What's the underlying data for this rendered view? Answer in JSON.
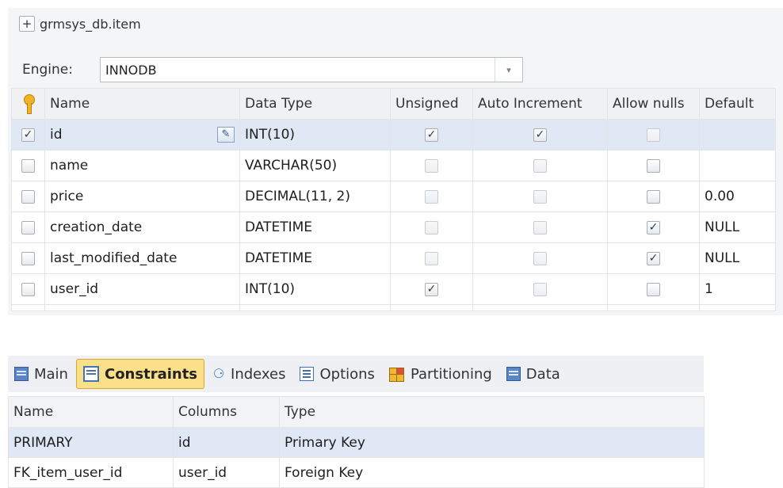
{
  "table_editor": {
    "title": "grmsys_db.item",
    "expand_symbol": "+",
    "engine": {
      "label": "Engine:",
      "value": "INNODB",
      "dropdown_arrow": "▾"
    },
    "columns_headers": [
      "Name",
      "Data Type",
      "Unsigned",
      "Auto Increment",
      "Allow nulls",
      "Default"
    ],
    "key_icon": "primary-key-icon",
    "rows": [
      {
        "selected": true,
        "key": true,
        "name": "id",
        "data_type": "INT(10)",
        "unsigned": true,
        "auto_increment": true,
        "allow_nulls": false,
        "default": ""
      },
      {
        "selected": false,
        "key": false,
        "name": "name",
        "data_type": "VARCHAR(50)",
        "unsigned": false,
        "auto_increment": false,
        "allow_nulls": false,
        "default": ""
      },
      {
        "selected": false,
        "key": false,
        "name": "price",
        "data_type": "DECIMAL(11, 2)",
        "unsigned": false,
        "auto_increment": false,
        "allow_nulls": false,
        "default": "0.00"
      },
      {
        "selected": false,
        "key": false,
        "name": "creation_date",
        "data_type": "DATETIME",
        "unsigned": false,
        "auto_increment": false,
        "allow_nulls": true,
        "default": "NULL"
      },
      {
        "selected": false,
        "key": false,
        "name": "last_modified_date",
        "data_type": "DATETIME",
        "unsigned": false,
        "auto_increment": false,
        "allow_nulls": true,
        "default": "NULL"
      },
      {
        "selected": false,
        "key": false,
        "name": "user_id",
        "data_type": "INT(10)",
        "unsigned": true,
        "auto_increment": false,
        "allow_nulls": false,
        "default": "1"
      }
    ],
    "check_glyph": "✓",
    "edit_glyph": "✎"
  },
  "bottom_tabs": [
    {
      "label": "Main",
      "icon": "table-icon",
      "active": false
    },
    {
      "label": "Constraints",
      "icon": "constraints-icon",
      "active": true
    },
    {
      "label": "Indexes",
      "icon": "indexes-icon",
      "active": false
    },
    {
      "label": "Options",
      "icon": "options-icon",
      "active": false
    },
    {
      "label": "Partitioning",
      "icon": "partitioning-icon",
      "active": false
    },
    {
      "label": "Data",
      "icon": "data-table-icon",
      "active": false
    }
  ],
  "constraints": {
    "headers": [
      "Name",
      "Columns",
      "Type"
    ],
    "rows": [
      {
        "name": "PRIMARY",
        "columns": "id",
        "type": "Primary Key",
        "selected": true
      },
      {
        "name": "FK_item_user_id",
        "columns": "user_id",
        "type": "Foreign Key",
        "selected": false
      }
    ]
  }
}
